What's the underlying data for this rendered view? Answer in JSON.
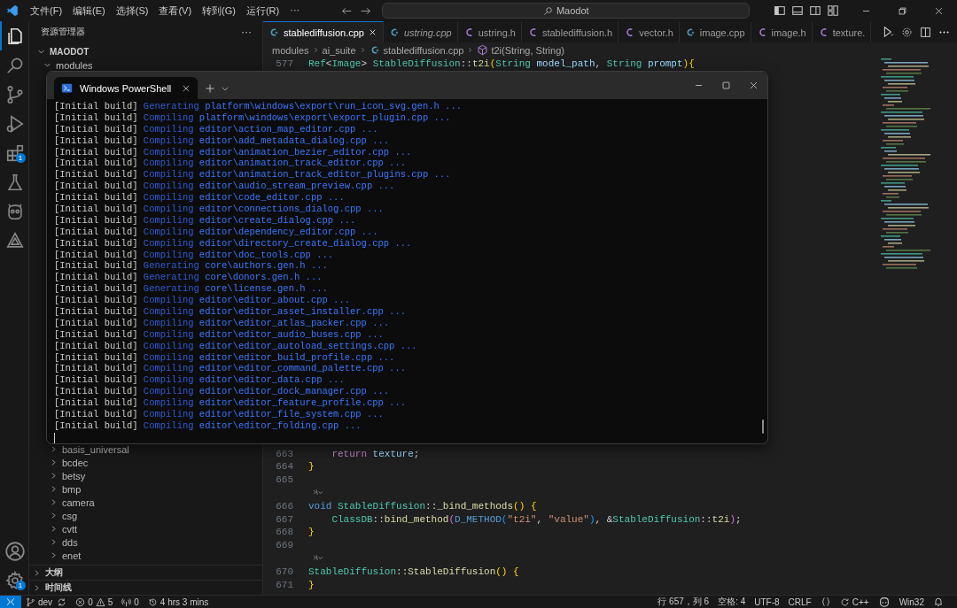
{
  "title_bar": {
    "menus": [
      "文件(F)",
      "编辑(E)",
      "选择(S)",
      "查看(V)",
      "转到(G)",
      "运行(R)",
      "···"
    ],
    "search": {
      "value": "Maodot"
    }
  },
  "activity_bar": {
    "items": [
      {
        "kind": "files",
        "selected": true
      },
      {
        "kind": "search",
        "selected": false
      },
      {
        "kind": "source-control",
        "selected": false
      },
      {
        "kind": "run",
        "selected": false
      },
      {
        "kind": "extensions",
        "selected": false,
        "badge": "1"
      },
      {
        "kind": "flask",
        "selected": false
      },
      {
        "kind": "robot",
        "selected": false
      },
      {
        "kind": "shapes",
        "selected": false
      }
    ],
    "bottom": [
      {
        "kind": "account"
      },
      {
        "kind": "settings",
        "badge": "1"
      }
    ]
  },
  "sidebar": {
    "title": "资源管理器",
    "more": "···",
    "root": "MAODOT",
    "tree": [
      {
        "label": "modules",
        "expanded": true,
        "children": [
          {
            "label": "basis_universal",
            "expanded": false
          },
          {
            "label": "bcdec",
            "expanded": false
          },
          {
            "label": "betsy",
            "expanded": false
          },
          {
            "label": "bmp",
            "expanded": false
          },
          {
            "label": "camera",
            "expanded": false
          },
          {
            "label": "csg",
            "expanded": false
          },
          {
            "label": "cvtt",
            "expanded": false
          },
          {
            "label": "dds",
            "expanded": false
          },
          {
            "label": "enet",
            "expanded": false
          }
        ]
      }
    ],
    "panels": [
      {
        "label": "大纲",
        "expanded": false
      },
      {
        "label": "时间线",
        "expanded": false
      }
    ]
  },
  "editor": {
    "tabs": [
      {
        "label": "stablediffusion.cpp",
        "kind": "cpp",
        "selected": true,
        "preview": false
      },
      {
        "label": "ustring.cpp",
        "kind": "cpp",
        "selected": false,
        "preview": true
      },
      {
        "label": "ustring.h",
        "kind": "h",
        "selected": false,
        "preview": false
      },
      {
        "label": "stablediffusion.h",
        "kind": "h",
        "selected": false,
        "preview": false
      },
      {
        "label": "vector.h",
        "kind": "h",
        "selected": false,
        "preview": false
      },
      {
        "label": "image.cpp",
        "kind": "cpp",
        "selected": false,
        "preview": false
      },
      {
        "label": "image.h",
        "kind": "h",
        "selected": false,
        "preview": false
      },
      {
        "label": "texture.",
        "kind": "h",
        "selected": false,
        "preview": false
      }
    ],
    "breadcrumb": [
      {
        "label": "modules",
        "kind": "folder"
      },
      {
        "label": "ai_suite",
        "kind": "folder"
      },
      {
        "label": "stablediffusion.cpp",
        "kind": "cpp"
      },
      {
        "label": "t2i(String, String)",
        "kind": "method"
      }
    ],
    "code_top": [
      {
        "kind": "code",
        "number": "577",
        "indented": false,
        "tokens": [
          {
            "text": "Ref",
            "kind": "type"
          },
          {
            "text": "<",
            "kind": "p"
          },
          {
            "text": "Image",
            "kind": "type"
          },
          {
            "text": "> ",
            "kind": "p"
          },
          {
            "text": "StableDiffusion",
            "kind": "type"
          },
          {
            "text": "::",
            "kind": "p"
          },
          {
            "text": "t2i",
            "kind": "fn"
          },
          {
            "text": "(",
            "kind": "br1"
          },
          {
            "text": "String ",
            "kind": "type"
          },
          {
            "text": "model_path",
            "kind": "var"
          },
          {
            "text": ", ",
            "kind": "p"
          },
          {
            "text": "String ",
            "kind": "type"
          },
          {
            "text": "prompt",
            "kind": "var"
          },
          {
            "text": "){",
            "kind": "br1"
          }
        ]
      }
    ],
    "code_bottom": [
      {
        "kind": "code",
        "number": "663",
        "indented": true,
        "tokens": [
          {
            "text": "return ",
            "kind": "ctl"
          },
          {
            "text": "texture",
            "kind": "var"
          },
          {
            "text": ";",
            "kind": "p"
          }
        ]
      },
      {
        "kind": "code",
        "number": "664",
        "indented": false,
        "tokens": [
          {
            "text": "}",
            "kind": "br1"
          }
        ]
      },
      {
        "kind": "code",
        "number": "665"
      },
      {
        "kind": "codelens"
      },
      {
        "kind": "code",
        "number": "666",
        "indented": false,
        "tokens": [
          {
            "text": "void ",
            "kind": "kw"
          },
          {
            "text": "StableDiffusion",
            "kind": "type"
          },
          {
            "text": "::",
            "kind": "p"
          },
          {
            "text": "_bind_methods",
            "kind": "fn"
          },
          {
            "text": "() {",
            "kind": "br1"
          }
        ]
      },
      {
        "kind": "code",
        "number": "667",
        "indented": true,
        "tokens": [
          {
            "text": "ClassDB",
            "kind": "type"
          },
          {
            "text": "::",
            "kind": "p"
          },
          {
            "text": "bind_method",
            "kind": "fn"
          },
          {
            "text": "(",
            "kind": "br2"
          },
          {
            "text": "D_METHOD",
            "kind": "kw"
          },
          {
            "text": "(",
            "kind": "br3"
          },
          {
            "text": "\"t2i\"",
            "kind": "str"
          },
          {
            "text": ", ",
            "kind": "p"
          },
          {
            "text": "\"value\"",
            "kind": "str"
          },
          {
            "text": ")",
            "kind": "br3"
          },
          {
            "text": ", &",
            "kind": "p"
          },
          {
            "text": "StableDiffusion",
            "kind": "type"
          },
          {
            "text": "::",
            "kind": "p"
          },
          {
            "text": "t2i",
            "kind": "fn"
          },
          {
            "text": ")",
            "kind": "br2"
          },
          {
            "text": ";",
            "kind": "p"
          }
        ]
      },
      {
        "kind": "code",
        "number": "668",
        "indented": false,
        "tokens": [
          {
            "text": "}",
            "kind": "br1"
          }
        ]
      },
      {
        "kind": "code",
        "number": "669"
      },
      {
        "kind": "codelens"
      },
      {
        "kind": "code",
        "number": "670",
        "indented": false,
        "tokens": [
          {
            "text": "StableDiffusion",
            "kind": "type"
          },
          {
            "text": "::",
            "kind": "p"
          },
          {
            "text": "StableDiffusion",
            "kind": "fn"
          },
          {
            "text": "() {",
            "kind": "br1"
          }
        ]
      },
      {
        "kind": "code",
        "number": "671",
        "indented": false,
        "tokens": [
          {
            "text": "}",
            "kind": "br1"
          }
        ]
      }
    ]
  },
  "terminal": {
    "tab": "Windows PowerShell",
    "lines": [
      {
        "prefix": "[Initial build]",
        "verb": "Generating",
        "target": "platform\\windows\\export\\run_icon_svg.gen.h ..."
      },
      {
        "prefix": "[Initial build]",
        "verb": "Compiling",
        "target": "platform\\windows\\export\\export_plugin.cpp ..."
      },
      {
        "prefix": "[Initial build]",
        "verb": "Compiling",
        "target": "editor\\action_map_editor.cpp ..."
      },
      {
        "prefix": "[Initial build]",
        "verb": "Compiling",
        "target": "editor\\add_metadata_dialog.cpp ..."
      },
      {
        "prefix": "[Initial build]",
        "verb": "Compiling",
        "target": "editor\\animation_bezier_editor.cpp ..."
      },
      {
        "prefix": "[Initial build]",
        "verb": "Compiling",
        "target": "editor\\animation_track_editor.cpp ..."
      },
      {
        "prefix": "[Initial build]",
        "verb": "Compiling",
        "target": "editor\\animation_track_editor_plugins.cpp ..."
      },
      {
        "prefix": "[Initial build]",
        "verb": "Compiling",
        "target": "editor\\audio_stream_preview.cpp ..."
      },
      {
        "prefix": "[Initial build]",
        "verb": "Compiling",
        "target": "editor\\code_editor.cpp ..."
      },
      {
        "prefix": "[Initial build]",
        "verb": "Compiling",
        "target": "editor\\connections_dialog.cpp ..."
      },
      {
        "prefix": "[Initial build]",
        "verb": "Compiling",
        "target": "editor\\create_dialog.cpp ..."
      },
      {
        "prefix": "[Initial build]",
        "verb": "Compiling",
        "target": "editor\\dependency_editor.cpp ..."
      },
      {
        "prefix": "[Initial build]",
        "verb": "Compiling",
        "target": "editor\\directory_create_dialog.cpp ..."
      },
      {
        "prefix": "[Initial build]",
        "verb": "Compiling",
        "target": "editor\\doc_tools.cpp ..."
      },
      {
        "prefix": "[Initial build]",
        "verb": "Generating",
        "target": "core\\authors.gen.h ..."
      },
      {
        "prefix": "[Initial build]",
        "verb": "Generating",
        "target": "core\\donors.gen.h ..."
      },
      {
        "prefix": "[Initial build]",
        "verb": "Generating",
        "target": "core\\license.gen.h ..."
      },
      {
        "prefix": "[Initial build]",
        "verb": "Compiling",
        "target": "editor\\editor_about.cpp ..."
      },
      {
        "prefix": "[Initial build]",
        "verb": "Compiling",
        "target": "editor\\editor_asset_installer.cpp ..."
      },
      {
        "prefix": "[Initial build]",
        "verb": "Compiling",
        "target": "editor\\editor_atlas_packer.cpp ..."
      },
      {
        "prefix": "[Initial build]",
        "verb": "Compiling",
        "target": "editor\\editor_audio_buses.cpp ..."
      },
      {
        "prefix": "[Initial build]",
        "verb": "Compiling",
        "target": "editor\\editor_autoload_settings.cpp ..."
      },
      {
        "prefix": "[Initial build]",
        "verb": "Compiling",
        "target": "editor\\editor_build_profile.cpp ..."
      },
      {
        "prefix": "[Initial build]",
        "verb": "Compiling",
        "target": "editor\\editor_command_palette.cpp ..."
      },
      {
        "prefix": "[Initial build]",
        "verb": "Compiling",
        "target": "editor\\editor_data.cpp ..."
      },
      {
        "prefix": "[Initial build]",
        "verb": "Compiling",
        "target": "editor\\editor_dock_manager.cpp ..."
      },
      {
        "prefix": "[Initial build]",
        "verb": "Compiling",
        "target": "editor\\editor_feature_profile.cpp ..."
      },
      {
        "prefix": "[Initial build]",
        "verb": "Compiling",
        "target": "editor\\editor_file_system.cpp ..."
      },
      {
        "prefix": "[Initial build]",
        "verb": "Compiling",
        "target": "editor\\editor_folding.cpp ..."
      }
    ]
  },
  "status_bar": {
    "left": [
      {
        "kind": "remote"
      },
      {
        "kind": "branch",
        "text": "dev"
      },
      {
        "kind": "sync"
      },
      {
        "kind": "problems",
        "errors": "0",
        "warnings": "5"
      },
      {
        "kind": "ports",
        "text": "0"
      },
      {
        "kind": "time",
        "text": "4 hrs 3 mins"
      }
    ],
    "right": [
      {
        "kind": "text",
        "text": "行 657，列 6"
      },
      {
        "kind": "text",
        "text": "空格: 4"
      },
      {
        "kind": "text",
        "text": "UTF-8"
      },
      {
        "kind": "text",
        "text": "CRLF"
      },
      {
        "kind": "braces"
      },
      {
        "kind": "language",
        "text": "C++"
      },
      {
        "kind": "copilot"
      },
      {
        "kind": "text",
        "text": "Win32"
      },
      {
        "kind": "bell"
      }
    ]
  }
}
